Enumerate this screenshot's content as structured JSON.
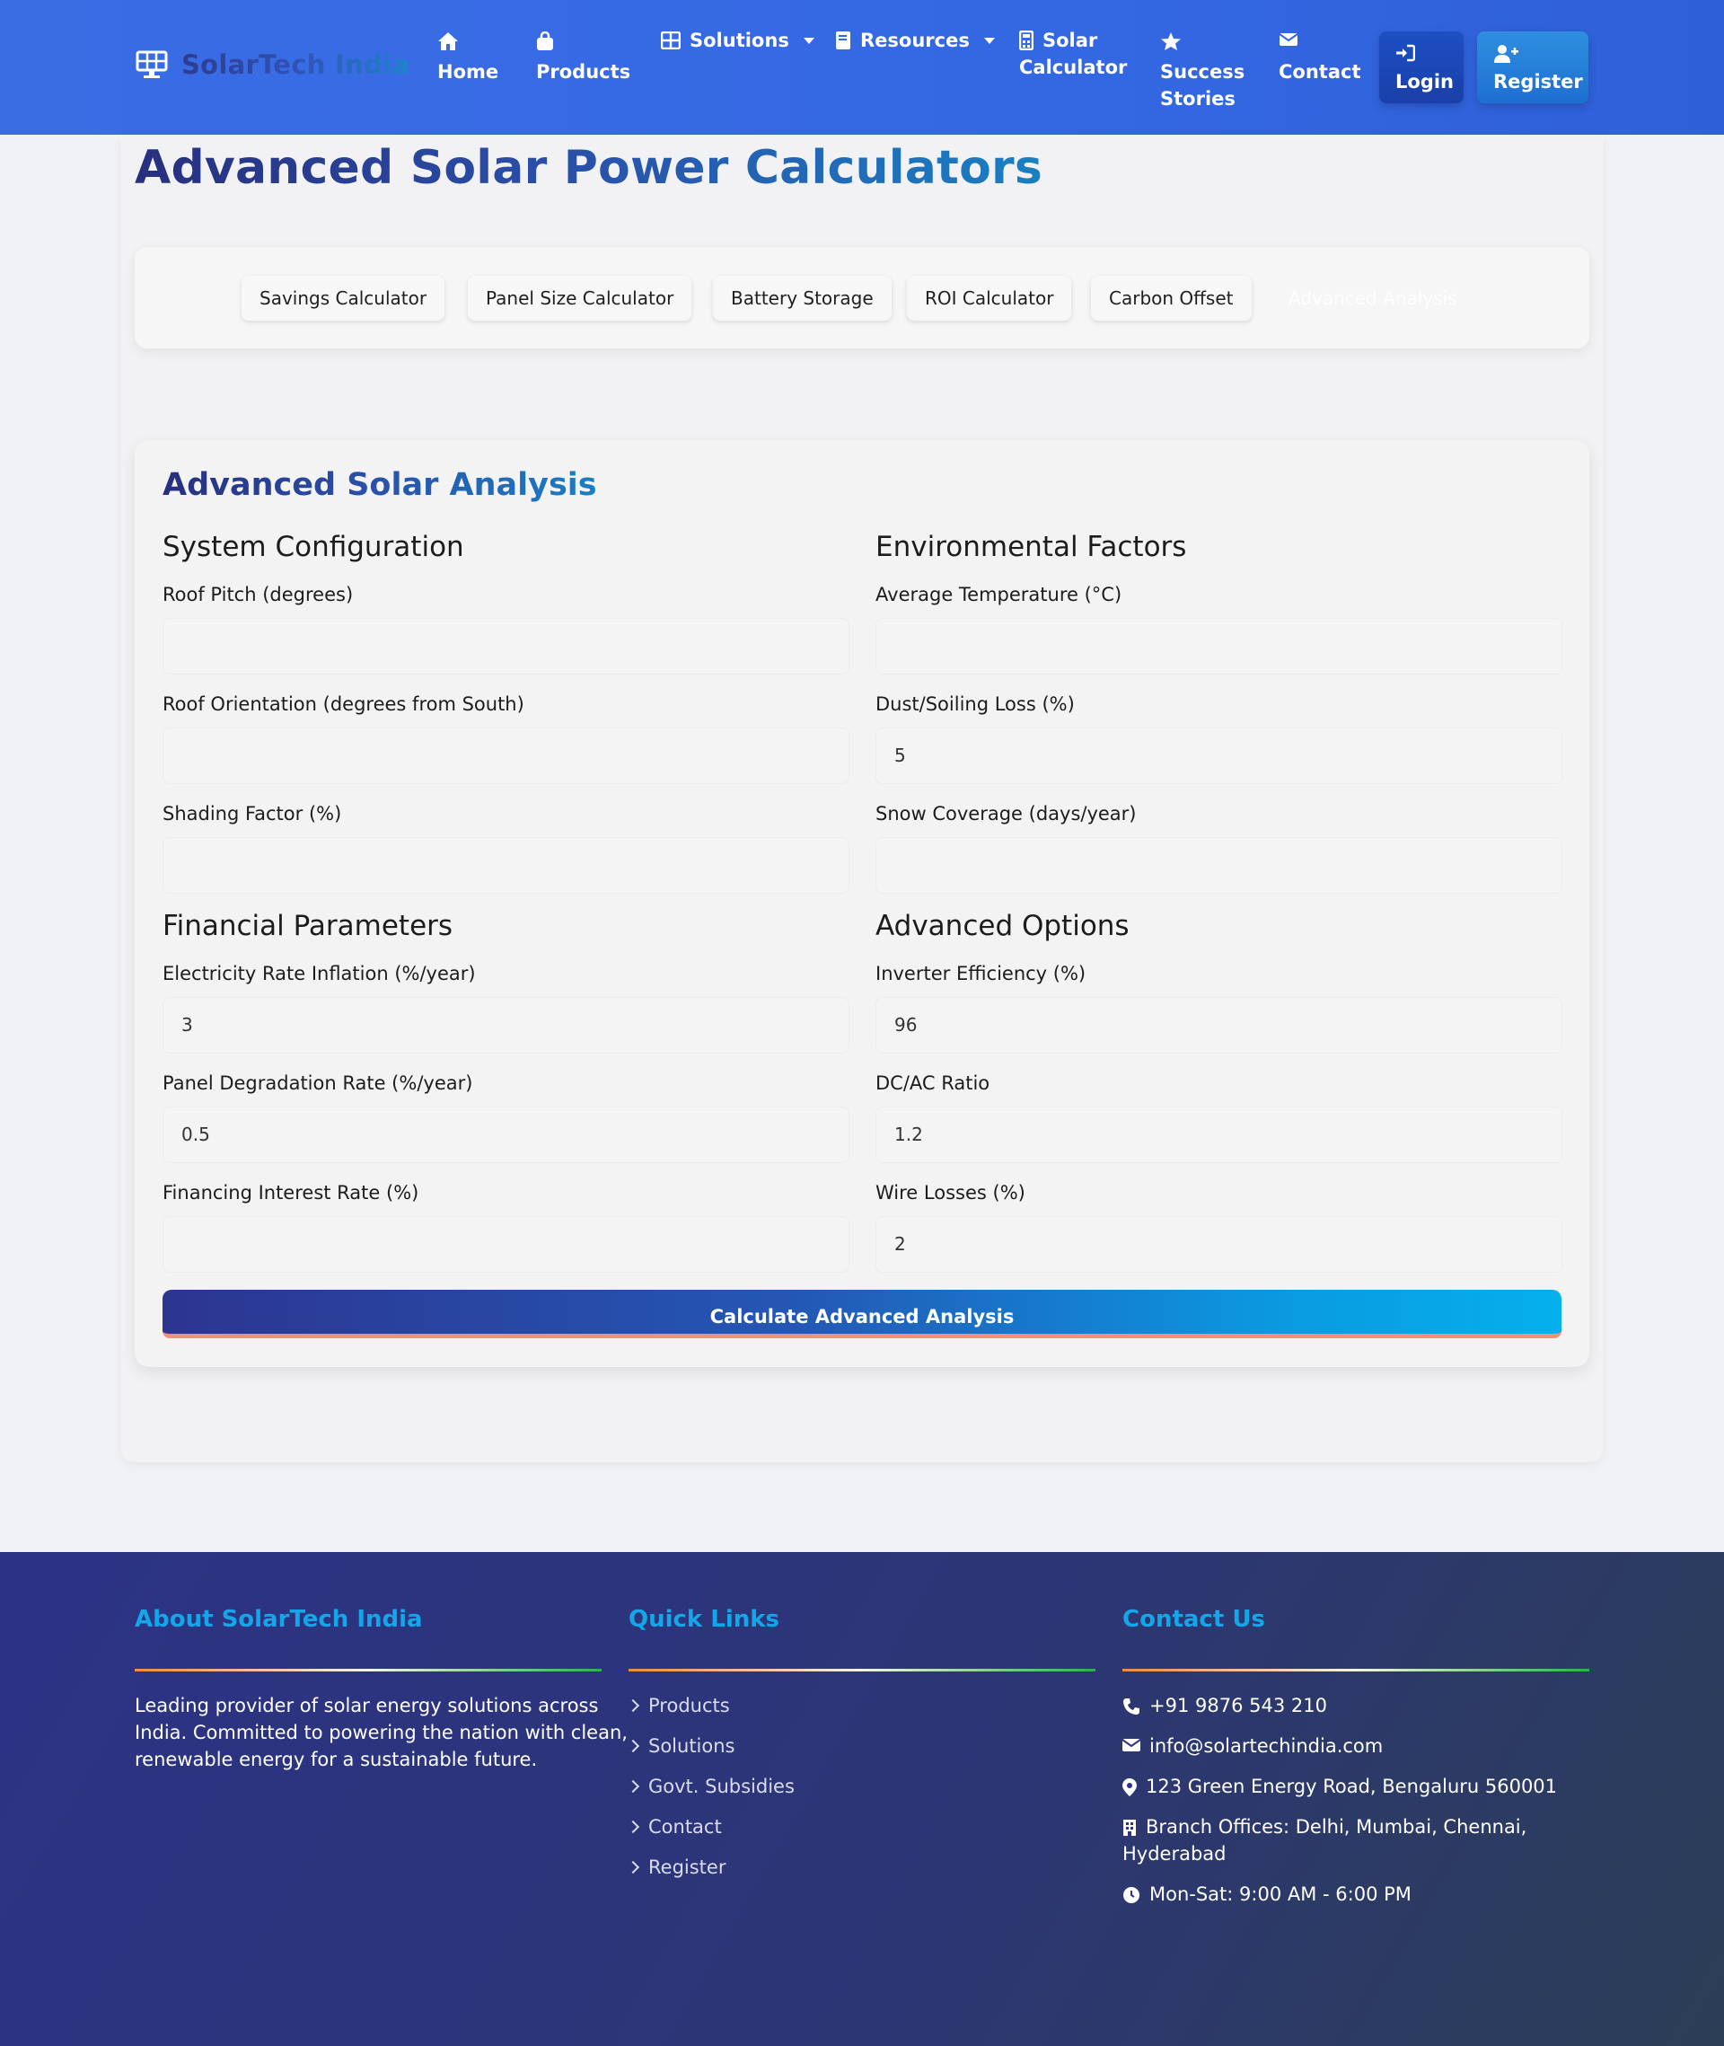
{
  "brand": {
    "name": "SolarTech India"
  },
  "nav": {
    "home": "Home",
    "products": "Products",
    "solutions": "Solutions",
    "resources": "Resources",
    "solar_calculator_1": "Solar",
    "solar_calculator_2": "Calculator",
    "success_1": "Success",
    "success_2": "Stories",
    "contact": "Contact",
    "login": "Login",
    "register": "Register"
  },
  "page": {
    "title": "Advanced Solar Power Calculators"
  },
  "tabs": [
    {
      "label": "Savings Calculator"
    },
    {
      "label": "Panel Size Calculator"
    },
    {
      "label": "Battery Storage"
    },
    {
      "label": "ROI Calculator"
    },
    {
      "label": "Carbon Offset"
    },
    {
      "label": "Advanced Analysis",
      "active": true
    }
  ],
  "analysis": {
    "title": "Advanced Solar Analysis",
    "sections": {
      "system": "System Configuration",
      "environment": "Environmental Factors",
      "financial": "Financial Parameters",
      "advanced": "Advanced Options"
    },
    "fields": {
      "roof_pitch": {
        "label": "Roof Pitch (degrees)",
        "value": ""
      },
      "roof_orientation": {
        "label": "Roof Orientation (degrees from South)",
        "value": ""
      },
      "shading_factor": {
        "label": "Shading Factor (%)",
        "value": ""
      },
      "avg_temperature": {
        "label": "Average Temperature (°C)",
        "value": ""
      },
      "dust_loss": {
        "label": "Dust/Soiling Loss (%)",
        "value": "5"
      },
      "snow_coverage": {
        "label": "Snow Coverage (days/year)",
        "value": ""
      },
      "rate_inflation": {
        "label": "Electricity Rate Inflation (%/year)",
        "value": "3"
      },
      "degradation_rate": {
        "label": "Panel Degradation Rate (%/year)",
        "value": "0.5"
      },
      "financing_rate": {
        "label": "Financing Interest Rate (%)",
        "value": ""
      },
      "inverter_efficiency": {
        "label": "Inverter Efficiency (%)",
        "value": "96"
      },
      "dc_ac_ratio": {
        "label": "DC/AC Ratio",
        "value": "1.2"
      },
      "wire_losses": {
        "label": "Wire Losses (%)",
        "value": "2"
      }
    },
    "button": "Calculate Advanced Analysis"
  },
  "footer": {
    "about": {
      "heading": "About SolarTech India",
      "text_1": "Leading provider of solar energy solutions across",
      "text_2": "India. Committed to powering the nation with clean,",
      "text_3": "renewable energy for a sustainable future."
    },
    "links": {
      "heading": "Quick Links",
      "items": [
        "Products",
        "Solutions",
        "Govt. Subsidies",
        "Contact",
        "Register"
      ]
    },
    "contact": {
      "heading": "Contact Us",
      "phone": "+91 9876 543 210",
      "email": "info@solartechindia.com",
      "address": "123 Green Energy Road, Bengaluru 560001",
      "branches_1": "Branch Offices: Delhi, Mumbai, Chennai,",
      "branches_2": "Hyderabad",
      "hours": "Mon-Sat: 9:00 AM - 6:00 PM"
    }
  },
  "colors": {
    "nav_bg": "#3a6de4",
    "accent_blue": "#14a6e8",
    "title_dark": "#27307e",
    "footer_bg": "#2c3386"
  }
}
